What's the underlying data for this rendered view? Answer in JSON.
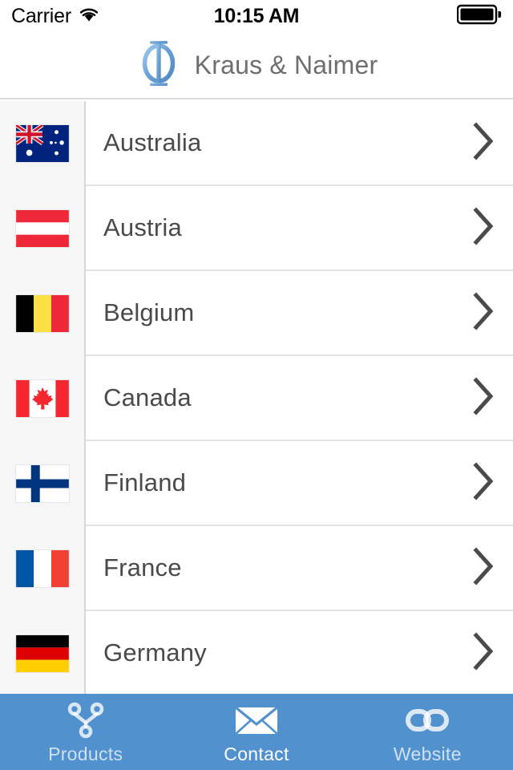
{
  "status_bar": {
    "carrier": "Carrier",
    "wifi_icon": "wifi-icon",
    "time": "10:15 AM",
    "battery_icon": "battery-full-icon"
  },
  "header": {
    "logo_icon": "phi-logo-icon",
    "title": "Kraus & Naimer",
    "title_color": "#6e6e6e",
    "logo_color": "#6ba3d6"
  },
  "list": {
    "chevron_icon": "chevron-right-icon",
    "rows": [
      {
        "name": "Australia",
        "flag_code": "au"
      },
      {
        "name": "Austria",
        "flag_code": "at"
      },
      {
        "name": "Belgium",
        "flag_code": "be"
      },
      {
        "name": "Canada",
        "flag_code": "ca"
      },
      {
        "name": "Finland",
        "flag_code": "fi"
      },
      {
        "name": "France",
        "flag_code": "fr"
      },
      {
        "name": "Germany",
        "flag_code": "de"
      }
    ]
  },
  "tab_bar": {
    "background_color": "#5191ce",
    "active_index": 1,
    "tabs": [
      {
        "label": "Products",
        "icon": "node-branch-icon",
        "active": false
      },
      {
        "label": "Contact",
        "icon": "envelope-icon",
        "active": true
      },
      {
        "label": "Website",
        "icon": "chain-link-icon",
        "active": false
      }
    ]
  }
}
